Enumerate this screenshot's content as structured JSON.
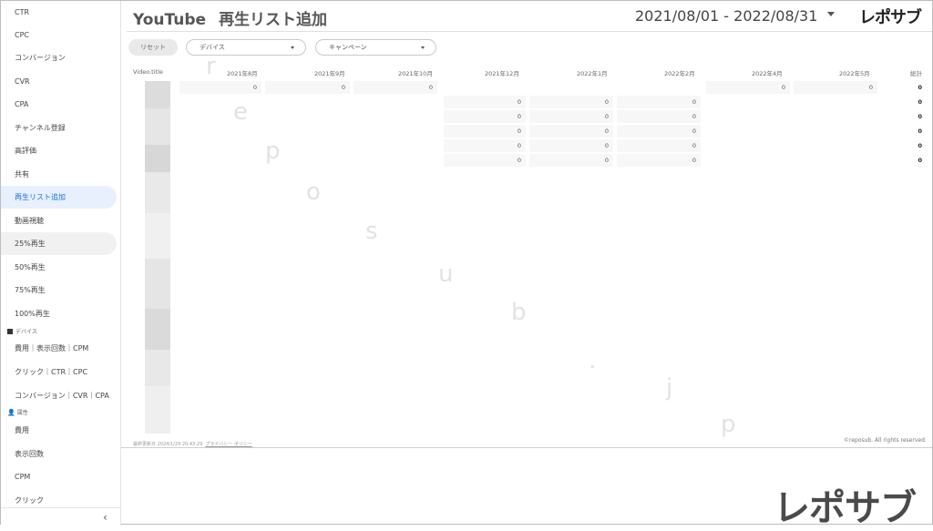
{
  "header": {
    "app_title": "YouTube",
    "page_title": "再生リスト追加",
    "date_range": "2021/08/01 - 2022/08/31",
    "logo": "レポサブ"
  },
  "sidebar": {
    "items_top": [
      "CTR",
      "CPC",
      "コンバージョン",
      "CVR",
      "CPA",
      "チャンネル登録",
      "高評価",
      "共有",
      "再生リスト追加",
      "動画視聴",
      "25%再生",
      "50%再生",
      "75%再生",
      "100%再生"
    ],
    "active_item": "再生リスト追加",
    "section_device": "デバイス",
    "device_items": [
      "費用｜表示回数｜CPM",
      "クリック｜CTR｜CPC",
      "コンバージョン｜CVR｜CPA"
    ],
    "section_attr": "属性",
    "attr_items": [
      "費用",
      "表示回数",
      "CPM",
      "クリック"
    ],
    "collapse_icon": "chevron-left-icon"
  },
  "filters": {
    "reset_label": "リセット",
    "device_placeholder": "デバイス",
    "campaign_placeholder": "キャンペーン"
  },
  "table": {
    "title_header": "Video.title",
    "columns": [
      "2021年8月",
      "2021年9月",
      "2021年10月",
      "2021年12月",
      "2022年1月",
      "2022年2月",
      "2022年4月",
      "2022年5月",
      "総計"
    ],
    "rows": [
      [
        "0",
        "0",
        "0",
        "",
        "",
        "",
        "0",
        "0",
        "0"
      ],
      [
        "",
        "",
        "",
        "0",
        "0",
        "0",
        "",
        "",
        "0"
      ],
      [
        "",
        "",
        "",
        "0",
        "0",
        "0",
        "",
        "",
        "0"
      ],
      [
        "",
        "",
        "",
        "0",
        "0",
        "0",
        "",
        "",
        "0"
      ],
      [
        "",
        "",
        "",
        "0",
        "0",
        "0",
        "",
        "",
        "0"
      ],
      [
        "",
        "",
        "",
        "0",
        "0",
        "0",
        "",
        "",
        "0"
      ]
    ]
  },
  "footer": {
    "updated": "最終更新日 2024/1/29 20:43:29",
    "privacy": "プライバシー ポリシー",
    "copyright": "©reposub. All rights reserved."
  },
  "watermark": [
    "r",
    "e",
    "p",
    "o",
    "s",
    "u",
    "b",
    ".",
    "j",
    "p"
  ],
  "colors": {
    "active_bg": "#e8f0fe",
    "active_text": "#1a73e8"
  }
}
